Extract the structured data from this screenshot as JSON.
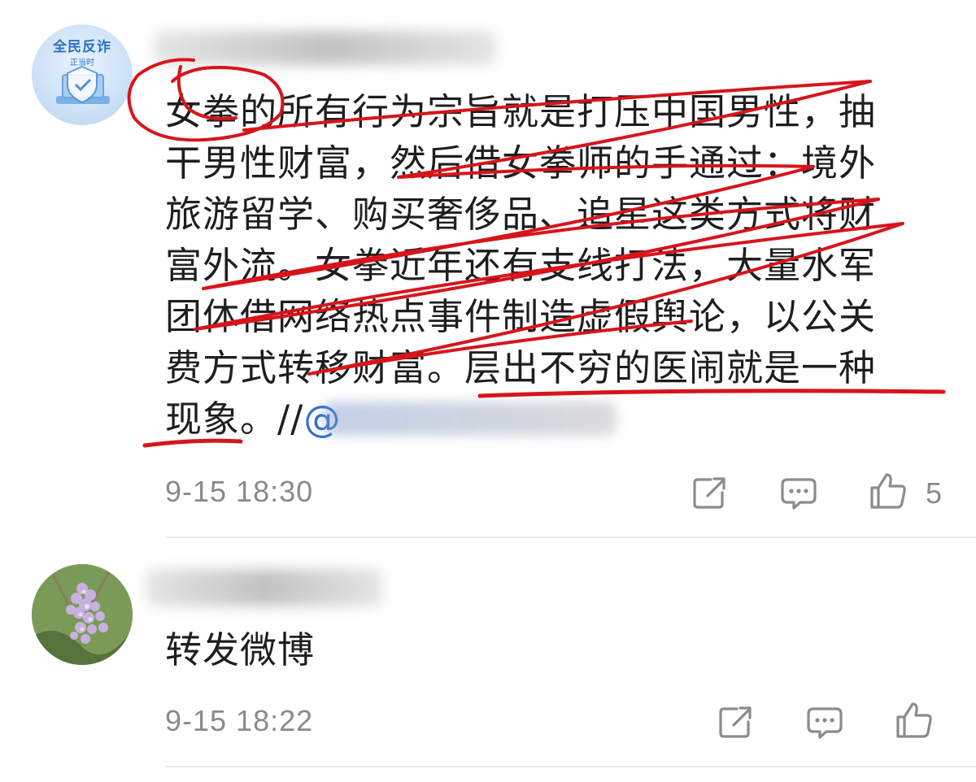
{
  "posts": [
    {
      "avatar": {
        "brand": "全民反诈",
        "brand_sub": "正当时"
      },
      "body_lines": [
        "女拳的所有行为宗旨就是打压中国男性，抽",
        "干男性财富，然后借女拳师的手通过：境外",
        "旅游留学、购买奢侈品、追星这类方式将财",
        "富外流。女拳近年还有支线打法，大量水军",
        "团体借网络热点事件制造虚假舆论，以公关",
        "费方式转移财富。层出不穷的医闹就是一种"
      ],
      "body_last": "现象。//",
      "mention": "@",
      "timestamp": "9-15 18:30",
      "like_count": "5"
    },
    {
      "body": "转发微博",
      "timestamp": "9-15 18:22"
    }
  ],
  "icons": {
    "share": "share-icon",
    "comment": "comment-icon",
    "like": "thumbs-up-icon"
  },
  "colors": {
    "annotation": "#d8141b",
    "mention": "#2f6fd1",
    "meta_text": "#8a8a8a",
    "icon": "#8c8c8c"
  }
}
